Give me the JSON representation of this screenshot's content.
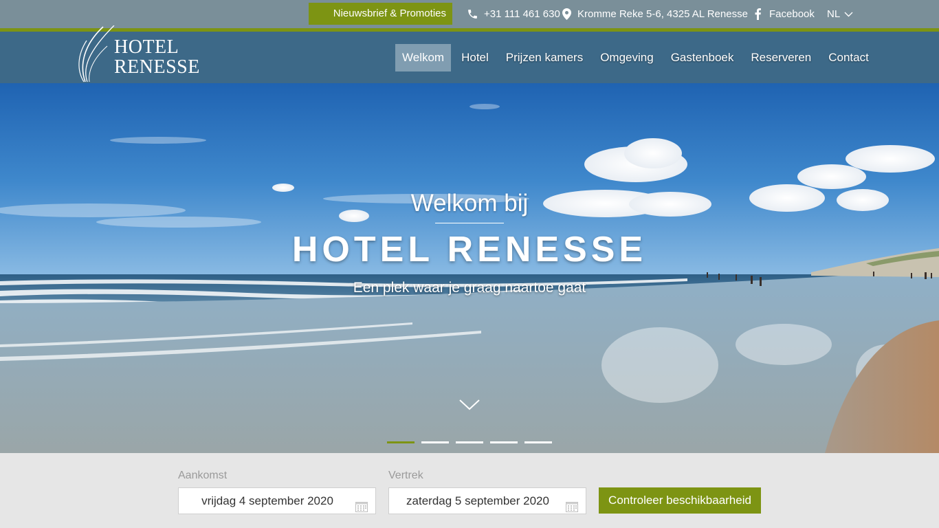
{
  "topbar": {
    "newsletter": "Nieuwsbrief & Promoties",
    "phone": "+31 111 461 630",
    "address": "Kromme Reke 5-6, 4325 AL Renesse",
    "facebook": "Facebook",
    "language": "NL",
    "icons": [
      "phone-icon",
      "map-pin-icon",
      "facebook-icon",
      "chevron-down-icon"
    ]
  },
  "logo": {
    "line1": "HOTEL",
    "line2": "RENESSE"
  },
  "nav": {
    "items": [
      "Welkom",
      "Hotel",
      "Prijzen kamers",
      "Omgeving",
      "Gastenboek",
      "Reserveren",
      "Contact"
    ],
    "active": "Welkom"
  },
  "hero": {
    "kicker": "Welkom bij",
    "title": "HOTEL RENESSE",
    "subtitle": "Een plek waar je graag naartoe gaat",
    "slides_total": 5,
    "slide_active": 1
  },
  "booking": {
    "arrival_label": "Aankomst",
    "arrival_value": "vrijdag 4 september 2020",
    "departure_label": "Vertrek",
    "departure_value": "zaterdag 5 september 2020",
    "check_button": "Controleer beschikbaarheid"
  },
  "colors": {
    "accent_green": "#7d9413",
    "nav_blue": "#3d6988",
    "topbar_grey": "#7a8f99"
  }
}
